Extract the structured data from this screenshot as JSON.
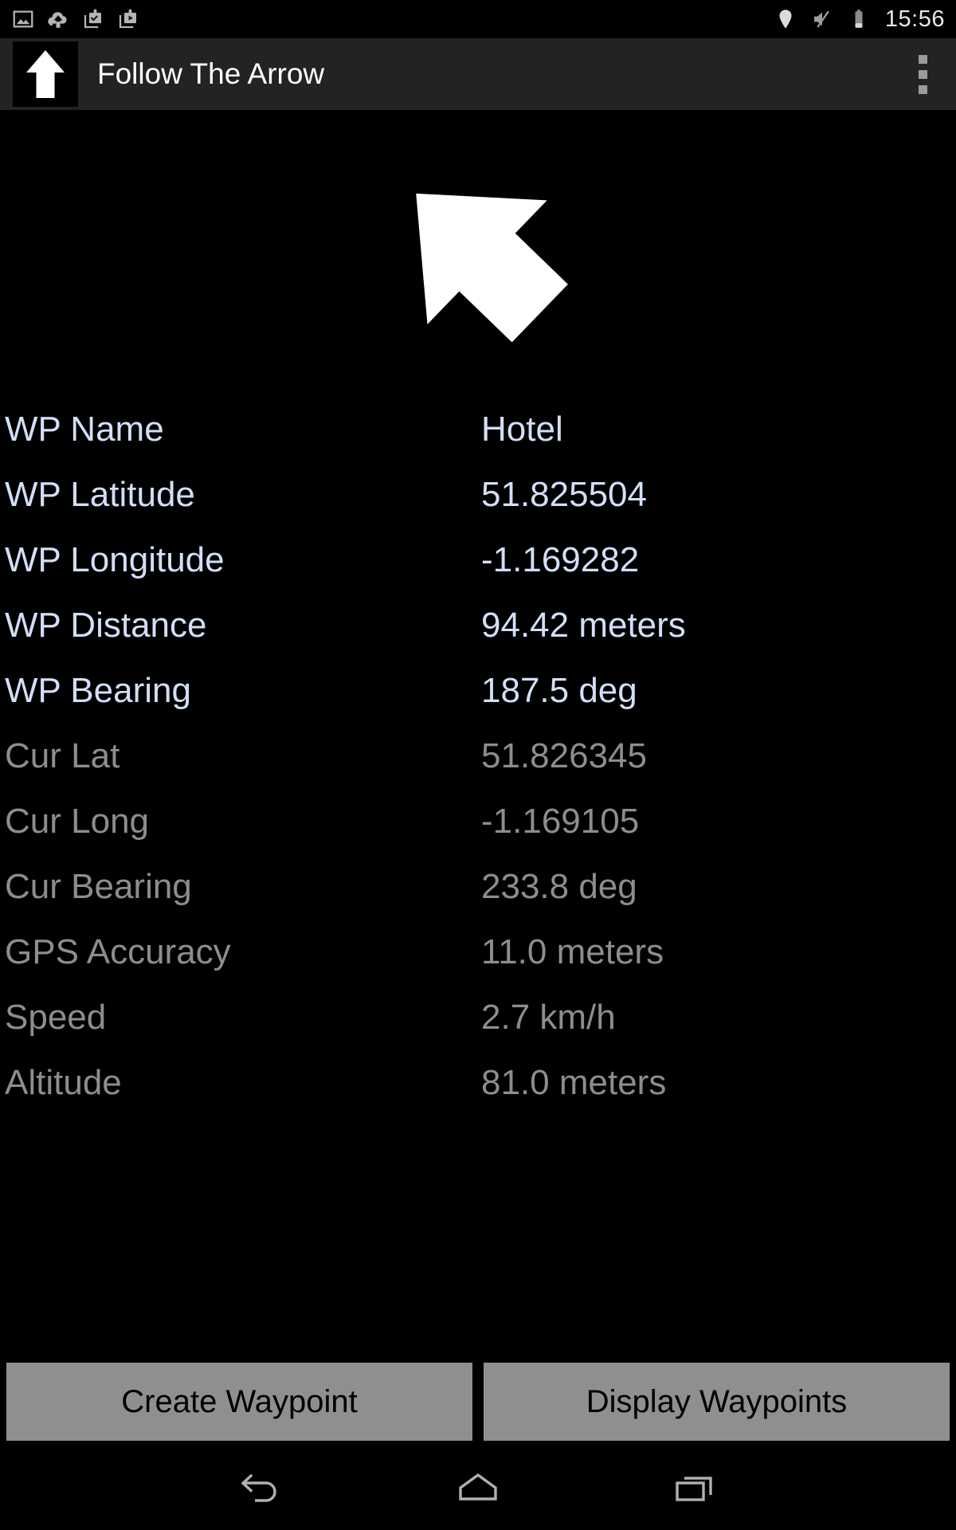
{
  "status_bar": {
    "icons": [
      "screenshot-icon",
      "cloud-upload-icon",
      "backup-check-icon",
      "backup-play-icon"
    ],
    "right_icons": [
      "location-pin-icon",
      "volume-muted-icon",
      "battery-icon"
    ],
    "clock": "15:56"
  },
  "app_bar": {
    "icon": "up-arrow-app-icon",
    "title": "Follow The Arrow",
    "overflow": "overflow-menu-icon"
  },
  "compass": {
    "icon": "direction-arrow",
    "rotation_deg": -46
  },
  "rows": [
    {
      "label": "WP Name",
      "value": "Hotel",
      "group": "wp"
    },
    {
      "label": "WP Latitude",
      "value": "51.825504",
      "group": "wp"
    },
    {
      "label": "WP Longitude",
      "value": "-1.169282",
      "group": "wp"
    },
    {
      "label": "WP Distance",
      "value": "94.42 meters",
      "group": "wp"
    },
    {
      "label": "WP Bearing",
      "value": "187.5 deg",
      "group": "wp"
    },
    {
      "label": "Cur Lat",
      "value": "51.826345",
      "group": "cur"
    },
    {
      "label": "Cur Long",
      "value": "-1.169105",
      "group": "cur"
    },
    {
      "label": "Cur Bearing",
      "value": "233.8 deg",
      "group": "cur"
    },
    {
      "label": "GPS Accuracy",
      "value": "11.0 meters",
      "group": "cur"
    },
    {
      "label": "Speed",
      "value": "2.7 km/h",
      "group": "cur"
    },
    {
      "label": "Altitude",
      "value": "81.0 meters",
      "group": "cur"
    }
  ],
  "buttons": {
    "create_waypoint": "Create Waypoint",
    "display_waypoints": "Display Waypoints"
  },
  "nav_bar": {
    "back": "back-icon",
    "home": "home-icon",
    "recents": "recents-icon"
  },
  "colors": {
    "background": "#000000",
    "app_bar": "#232323",
    "wp_text": "#d3def7",
    "cur_text": "#8d8d8d",
    "button_bg": "#8f8f8f",
    "button_text": "#000000",
    "status_icon": "#b5b5b5"
  }
}
